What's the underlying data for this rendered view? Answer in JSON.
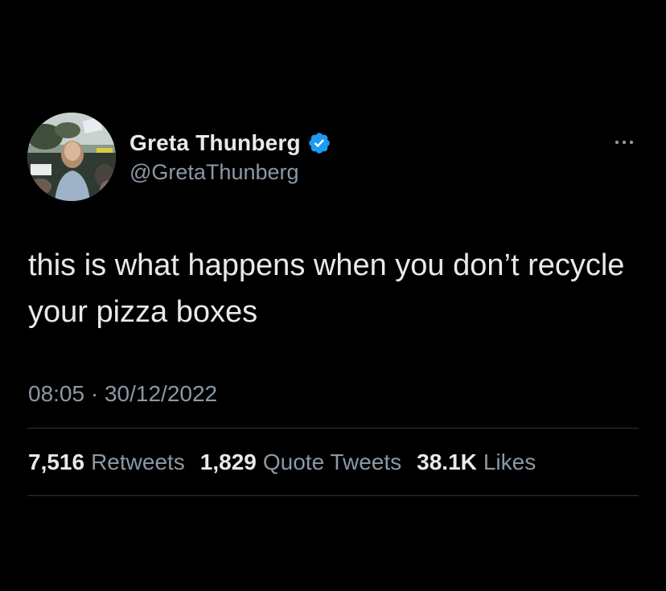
{
  "tweet": {
    "author": {
      "display_name": "Greta Thunberg",
      "handle": "@GretaThunberg",
      "verified": true,
      "verified_icon": "verified-badge-icon",
      "avatar": "profile-photo"
    },
    "more_icon": "more-options-icon",
    "text": "this is what happens when you don’t recycle your pizza boxes",
    "time": "08:05",
    "separator": "·",
    "date": "30/12/2022",
    "stats": {
      "retweets": {
        "count": "7,516",
        "label": "Retweets"
      },
      "quote_tweets": {
        "count": "1,829",
        "label": "Quote Tweets"
      },
      "likes": {
        "count": "38.1K",
        "label": "Likes"
      }
    }
  },
  "colors": {
    "background": "#000000",
    "primary_text": "#e7e9ea",
    "secondary_text": "#8b98a5",
    "verified_blue": "#1d9bf0",
    "divider": "#2f3336"
  }
}
